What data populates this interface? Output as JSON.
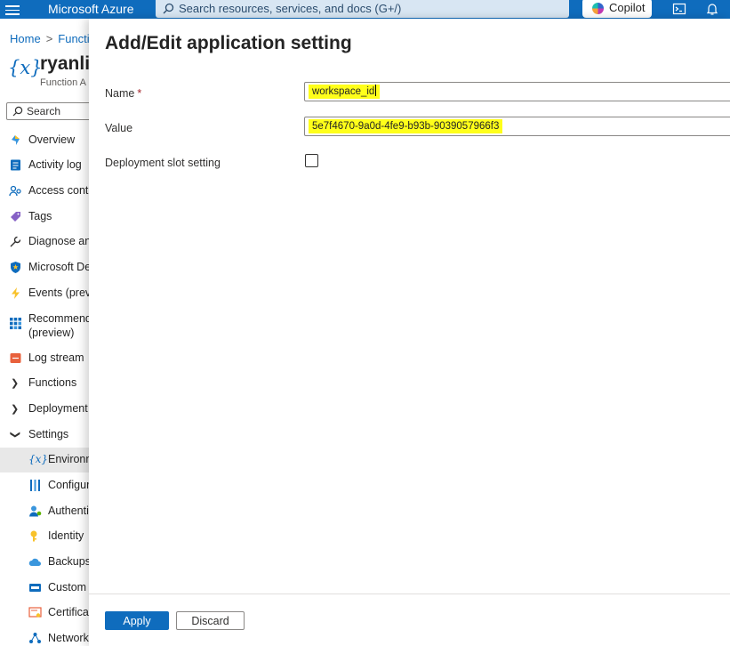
{
  "topbar": {
    "brand": "Microsoft Azure",
    "search_placeholder": "Search resources, services, and docs (G+/)",
    "copilot_label": "Copilot",
    "accent_color": "#0f6cbd"
  },
  "breadcrumb": {
    "home": "Home",
    "second": "Functi"
  },
  "resource": {
    "icon": "{x}",
    "name": "ryanli",
    "type": "Function A"
  },
  "left_search": {
    "label": "Search"
  },
  "nav": {
    "overview": "Overview",
    "activity_log": "Activity log",
    "access_control": "Access contr",
    "tags": "Tags",
    "diagnose": "Diagnose and",
    "defender": "Microsoft De",
    "events": "Events (previ",
    "recommend": "Recommend",
    "recommend_sub": "(preview)",
    "log_stream": "Log stream",
    "functions": "Functions",
    "deployment": "Deployment",
    "settings": "Settings",
    "environment": "Environm",
    "configuration": "Configur",
    "authentication": "Authenti",
    "identity": "Identity",
    "backups": "Backups",
    "custom": "Custom",
    "certificates": "Certifica",
    "networking": "Network"
  },
  "panel": {
    "title": "Add/Edit application setting",
    "name_label": "Name",
    "required_marker": "*",
    "name_value": "workspace_id",
    "value_label": "Value",
    "value_value": "5e7f4670-9a0d-4fe9-b93b-9039057966f3",
    "slot_label": "Deployment slot setting",
    "slot_checked": false,
    "highlight_color": "#ffff1a",
    "apply_label": "Apply",
    "discard_label": "Discard"
  }
}
